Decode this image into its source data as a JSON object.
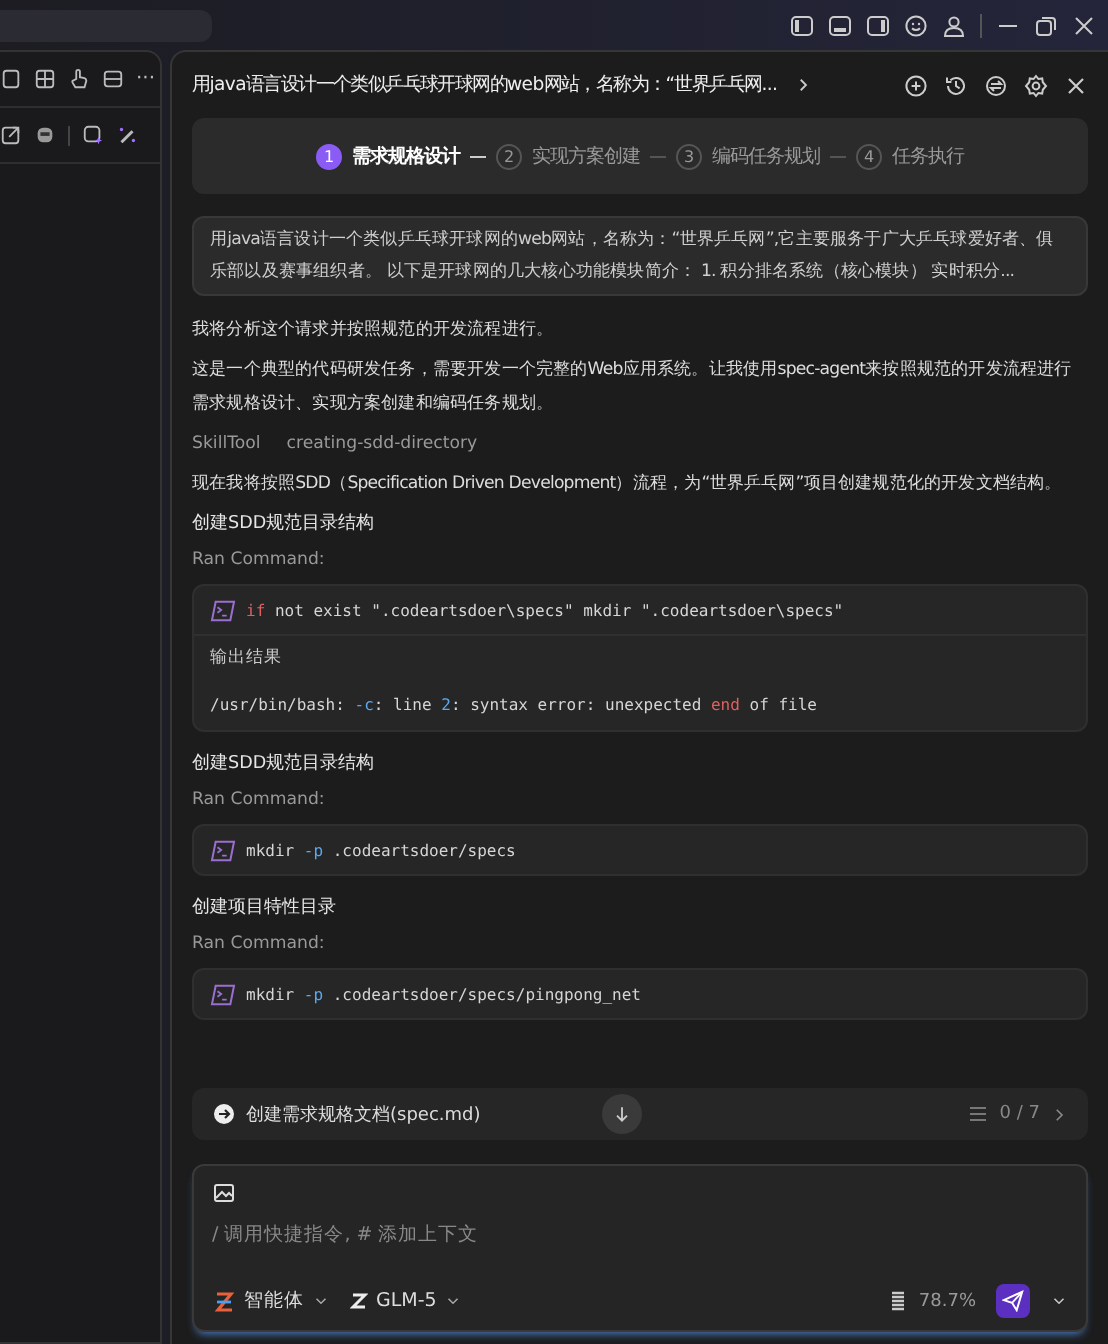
{
  "left_panel": {
    "more": "···"
  },
  "chat": {
    "title": "用java语言设计一个类似乒乓球开球网的web网站，名称为：“世界乒乓网...",
    "steps": [
      {
        "number": "1",
        "label": "需求规格设计",
        "selected": true
      },
      {
        "number": "2",
        "label": "实现方案创建",
        "selected": false
      },
      {
        "number": "3",
        "label": "编码任务规划",
        "selected": false
      },
      {
        "number": "4",
        "label": "任务执行",
        "selected": false
      }
    ],
    "user_message": "用java语言设计一个类似乒乓球开球网的web网站，名称为：“世界乒乓网”,它主要服务于广大乒乓球爱好者、俱乐部以及赛事组织者。 以下是开球网的几大核心功能模块简介： 1. 积分排名系统（核心模块） 实时积分...",
    "items": [
      {
        "kind": "text",
        "text": "我将分析这个请求并按照规范的开发流程进行。"
      },
      {
        "kind": "text",
        "text": "这是一个典型的代码研发任务，需要开发一个完整的Web应用系统。让我使用spec-agent来按照规范的开发流程进行需求规格设计、实现方案创建和编码任务规划。"
      },
      {
        "kind": "tool",
        "name": "SkillTool",
        "value": "creating-sdd-directory"
      },
      {
        "kind": "text",
        "text": "现在我将按照SDD（Specification Driven Development）流程，为“世界乒乓网”项目创建规范化的开发文档结构。"
      },
      {
        "kind": "heading",
        "text": "创建SDD规范目录结构"
      },
      {
        "kind": "label",
        "text": "Ran Command:"
      },
      {
        "kind": "command",
        "tokens": [
          {
            "kind": "keyword",
            "text": "if"
          },
          {
            "kind": "plain",
            "text": " not exist \".codeartsdoer\\specs\" mkdir \".codeartsdoer\\specs\""
          }
        ],
        "output_label": "输出结果",
        "output": [
          {
            "kind": "plain",
            "text": "/usr/bin/bash: "
          },
          {
            "kind": "flag",
            "text": "-c"
          },
          {
            "kind": "plain",
            "text": ": line "
          },
          {
            "kind": "flag",
            "text": "2"
          },
          {
            "kind": "plain",
            "text": ": syntax error: unexpected "
          },
          {
            "kind": "keyword",
            "text": "end"
          },
          {
            "kind": "plain",
            "text": " of file"
          }
        ]
      },
      {
        "kind": "heading",
        "text": "创建SDD规范目录结构"
      },
      {
        "kind": "label",
        "text": "Ran Command:"
      },
      {
        "kind": "command",
        "tokens": [
          {
            "kind": "plain",
            "text": "mkdir "
          },
          {
            "kind": "flag",
            "text": "-p"
          },
          {
            "kind": "plain",
            "text": " .codeartsdoer/specs"
          }
        ]
      },
      {
        "kind": "heading",
        "text": "创建项目特性目录"
      },
      {
        "kind": "label",
        "text": "Ran Command:"
      },
      {
        "kind": "command",
        "tokens": [
          {
            "kind": "plain",
            "text": "mkdir "
          },
          {
            "kind": "flag",
            "text": "-p"
          },
          {
            "kind": "plain",
            "text": " .codeartsdoer/specs/pingpong_net"
          }
        ]
      }
    ],
    "task_bar": {
      "label": "创建需求规格文档(spec.md)",
      "count": "0 / 7"
    },
    "input": {
      "placeholder": "/ 调用快捷指令, # 添加上下文",
      "agent": "智能体",
      "model": "GLM-5",
      "usage": "78.7%"
    }
  }
}
